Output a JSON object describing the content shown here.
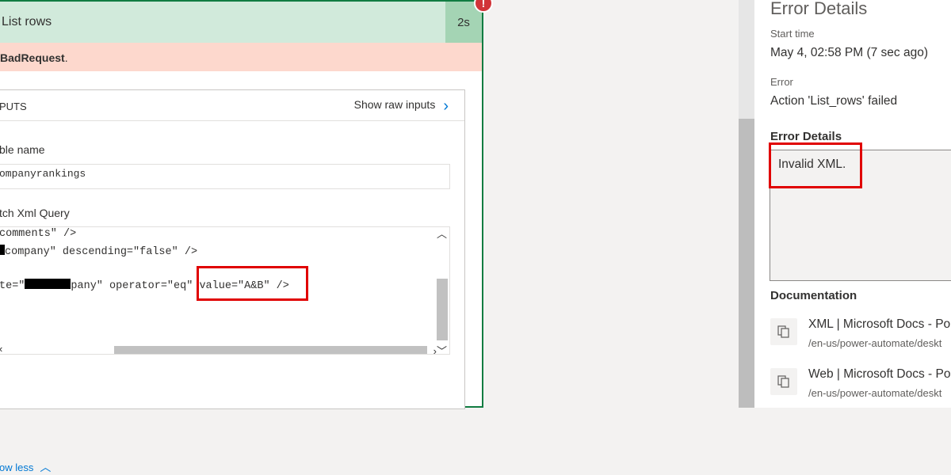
{
  "action": {
    "title": "List rows",
    "duration": "2s",
    "error_badge": "!",
    "error_banner": "BadRequest",
    "error_banner_suffix": "."
  },
  "inputs": {
    "header": "PUTS",
    "show_raw_inputs": "Show raw inputs",
    "show_raw_chevron": "›",
    "table_name_label": "ble name",
    "table_name_value": "ompanyrankings",
    "fetch_xml_label": "tch Xml Query",
    "code_lines": {
      "line1": "comments\" />",
      "line2a": "company\" descending=\"false\" />",
      "line3a": "te=\"",
      "line3b": "pany\" operator=\"eq\" ",
      "line3c": "value=\"A&B\" />"
    },
    "show_less": "ow less"
  },
  "error_panel": {
    "title": "Error Details",
    "start_time_label": "Start time",
    "start_time_value": "May 4, 02:58 PM (7 sec ago)",
    "error_label": "Error",
    "error_value": "Action 'List_rows' failed",
    "error_details_label": "Error Details",
    "error_details_value": "Invalid XML.",
    "documentation_label": "Documentation",
    "docs": [
      {
        "title": "XML | Microsoft Docs - Po",
        "url": "/en-us/power-automate/deskt"
      },
      {
        "title": "Web | Microsoft Docs - Po",
        "url": "/en-us/power-automate/deskt"
      }
    ]
  },
  "colors": {
    "header_green": "#d1eadb",
    "duration_green": "#a4d4b4",
    "error_banner": "#fdd8cd",
    "highlight_red": "#e00000",
    "link_blue": "#0078d4"
  }
}
